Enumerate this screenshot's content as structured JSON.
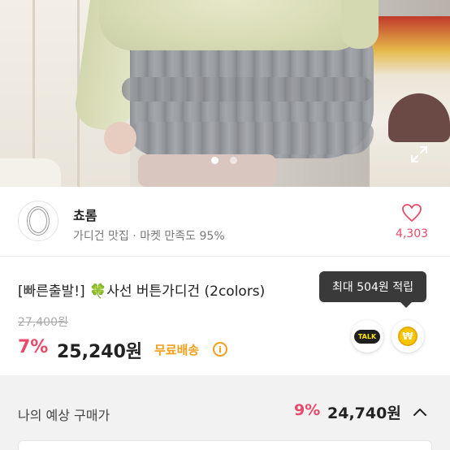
{
  "hero": {
    "slide_count": 2,
    "active_slide": 0
  },
  "shop": {
    "name": "쵸롬",
    "subtitle": "가디건 맛집 · 마켓 만족도 95%",
    "like_count": "4,303"
  },
  "product": {
    "title": "[빠른출발!] 🍀사선 버튼가디건 (2colors)",
    "original_price": "27,400원",
    "discount": "7%",
    "price": "25,240원",
    "free_shipping": "무료배송",
    "tooltip": "최대 504원 적립",
    "talk_label": "TALK",
    "coin_symbol": "₩"
  },
  "expected": {
    "label": "나의 예상 구매가",
    "discount": "9%",
    "price": "24,740원"
  },
  "colors": {
    "accent_pink": "#e84a6a",
    "shipping_orange": "#f0a019",
    "tooltip_bg": "#3a3a3a"
  }
}
